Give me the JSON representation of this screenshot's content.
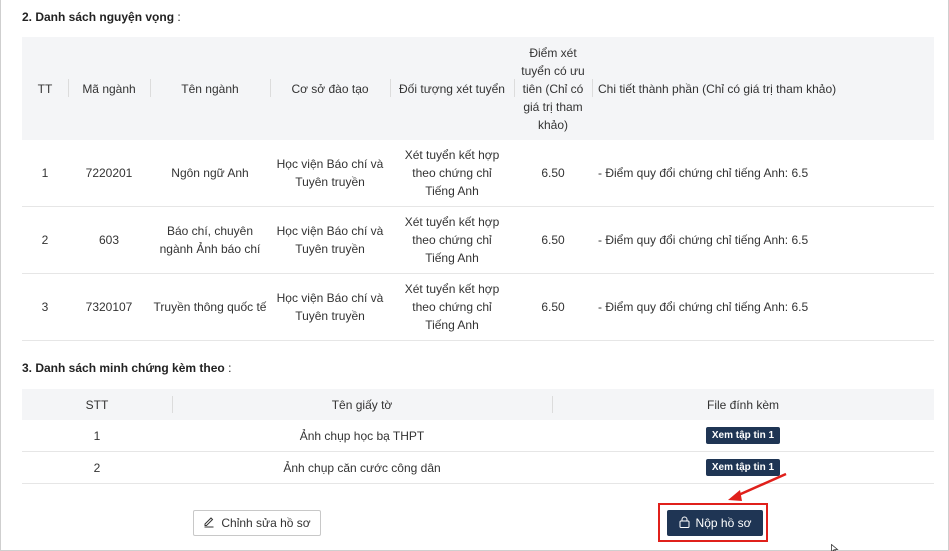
{
  "section2": {
    "title": "2. Danh sách nguyện vọng",
    "colon": ":"
  },
  "wishes_table": {
    "headers": {
      "tt": "TT",
      "ma_nganh": "Mã ngành",
      "ten_nganh": "Tên ngành",
      "co_so": "Cơ sở đào tạo",
      "doi_tuong": "Đối tượng xét tuyển",
      "diem": "Điểm xét tuyển có ưu tiên (Chỉ có giá trị tham khảo)",
      "chi_tiet": "Chi tiết thành phần (Chỉ có giá trị tham khảo)"
    },
    "rows": [
      {
        "tt": "1",
        "ma": "7220201",
        "ten": "Ngôn ngữ Anh",
        "co_so": "Học viện Báo chí và Tuyên truyền",
        "doi_tuong": "Xét tuyển kết hợp theo chứng chỉ Tiếng Anh",
        "diem": "6.50",
        "chi_tiet": "- Điểm quy đổi chứng chỉ tiếng Anh: 6.5"
      },
      {
        "tt": "2",
        "ma": "603",
        "ten": "Báo chí, chuyên ngành Ảnh báo chí",
        "co_so": "Học viện Báo chí và Tuyên truyền",
        "doi_tuong": "Xét tuyển kết hợp theo chứng chỉ Tiếng Anh",
        "diem": "6.50",
        "chi_tiet": "- Điểm quy đổi chứng chỉ tiếng Anh: 6.5"
      },
      {
        "tt": "3",
        "ma": "7320107",
        "ten": "Truyền thông quốc tế",
        "co_so": "Học viện Báo chí và Tuyên truyền",
        "doi_tuong": "Xét tuyển kết hợp theo chứng chỉ Tiếng Anh",
        "diem": "6.50",
        "chi_tiet": "- Điểm quy đổi chứng chỉ tiếng Anh: 6.5"
      }
    ]
  },
  "section3": {
    "title": "3. Danh sách minh chứng kèm theo",
    "colon": ":"
  },
  "evidence_table": {
    "headers": {
      "stt": "STT",
      "ten": "Tên giấy tờ",
      "file": "File đính kèm"
    },
    "rows": [
      {
        "stt": "1",
        "ten": "Ảnh chụp học bạ THPT",
        "file_button": "Xem tập tin 1"
      },
      {
        "stt": "2",
        "ten": "Ảnh chụp căn cước công dân",
        "file_button": "Xem tập tin 1"
      }
    ]
  },
  "actions": {
    "edit_label": "Chỉnh sửa hồ sơ",
    "submit_label": "Nộp hồ sơ",
    "edit_icon": "pencil-icon",
    "submit_icon": "lock-icon"
  },
  "colors": {
    "primary": "#1f3554",
    "highlight": "#e0201b",
    "header_bg": "#f4f5f7"
  }
}
